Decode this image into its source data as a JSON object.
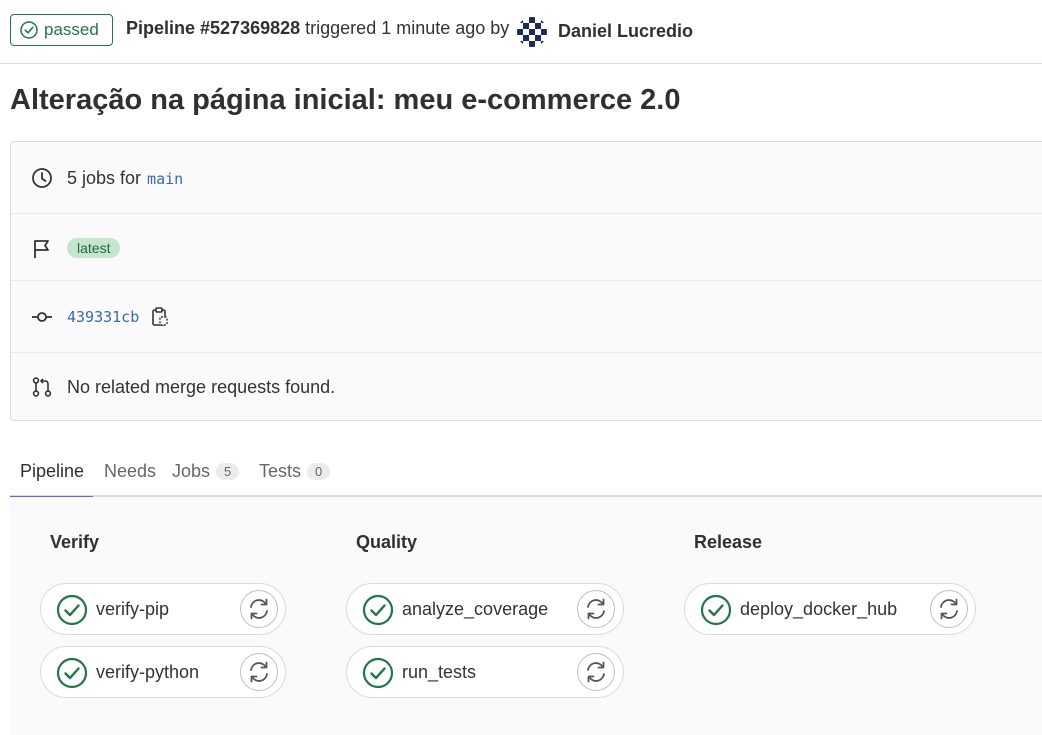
{
  "header": {
    "status": "passed",
    "pipeline_id": "Pipeline #527369828",
    "triggered_text": "triggered 1 minute ago by",
    "author": "Daniel Lucredio"
  },
  "title": "Alteração na página inicial: meu e-commerce 2.0",
  "info": {
    "jobs_count_text": "5 jobs for",
    "branch": "main",
    "tag": "latest",
    "commit_sha": "439331cb",
    "merge_requests_text": "No related merge requests found."
  },
  "tabs": [
    {
      "label": "Pipeline",
      "count": ""
    },
    {
      "label": "Needs",
      "count": ""
    },
    {
      "label": "Jobs",
      "count": "5"
    },
    {
      "label": "Tests",
      "count": "0"
    }
  ],
  "stages": [
    {
      "name": "Verify",
      "jobs": [
        "verify-pip",
        "verify-python"
      ]
    },
    {
      "name": "Quality",
      "jobs": [
        "analyze_coverage",
        "run_tests"
      ]
    },
    {
      "name": "Release",
      "jobs": [
        "deploy_docker_hub"
      ]
    }
  ],
  "colors": {
    "success": "#217645",
    "tab_accent": "#6666c4",
    "link": "#3c67b3"
  }
}
